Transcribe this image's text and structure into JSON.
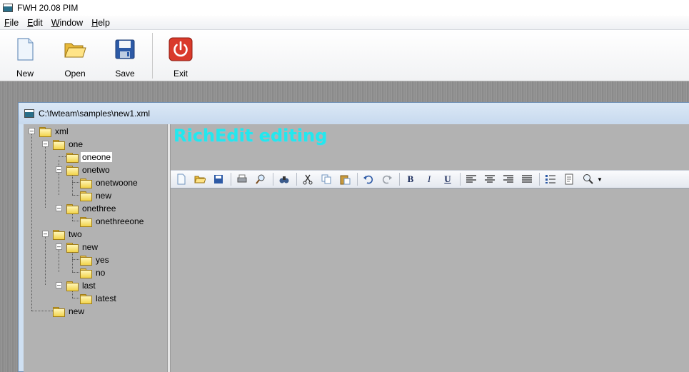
{
  "window": {
    "title": "FWH 20.08 PIM"
  },
  "menu": [
    "File",
    "Edit",
    "Window",
    "Help"
  ],
  "toolbar": {
    "new": "New",
    "open": "Open",
    "save": "Save",
    "exit": "Exit"
  },
  "child_window": {
    "title": "C:\\fwteam\\samples\\new1.xml"
  },
  "tree": {
    "xml": "xml",
    "one": "one",
    "oneone": "oneone",
    "onetwo": "onetwo",
    "onetwoone": "onetwoone",
    "onetwo_new": "new",
    "onethree": "onethree",
    "onethreeone": "onethreeone",
    "two": "two",
    "two_new": "new",
    "yes": "yes",
    "no": "no",
    "last": "last",
    "latest": "latest",
    "root_new": "new",
    "selected": "oneone"
  },
  "editor": {
    "heading": "RichEdit editing",
    "heading_color": "#22e8ee"
  },
  "richedit_toolbar": {
    "icons": [
      "new-doc-icon",
      "open-folder-icon",
      "save-disk-icon",
      "print-icon",
      "preview-icon",
      "find-icon",
      "cut-icon",
      "copy-icon",
      "paste-icon",
      "undo-icon",
      "redo-icon",
      "bold-icon",
      "italic-icon",
      "underline-icon",
      "align-left-icon",
      "align-center-icon",
      "align-right-icon",
      "justify-icon",
      "list-icon",
      "page-icon",
      "zoom-icon"
    ],
    "bold": "B",
    "italic": "I",
    "underline": "U"
  },
  "colors": {
    "accent_red": "#d93a2b",
    "pane_gray": "#b2b2b2"
  }
}
